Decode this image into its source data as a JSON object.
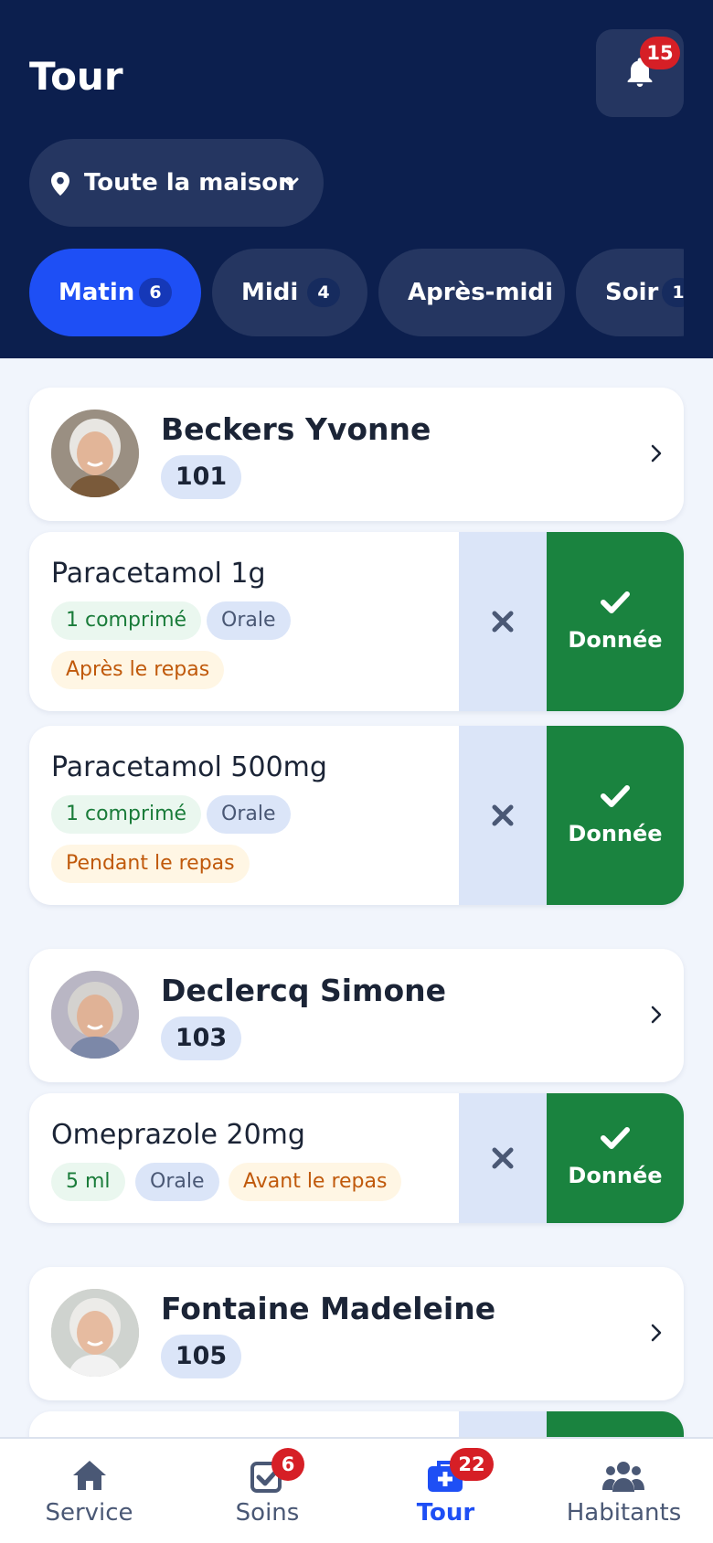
{
  "header": {
    "title": "Tour",
    "notifications_count": "15",
    "location_label": "Toute la maison",
    "tabs": [
      {
        "label": "Matin",
        "count": "6",
        "active": true
      },
      {
        "label": "Midi",
        "count": "4",
        "active": false
      },
      {
        "label": "Après-midi",
        "count": "",
        "active": false
      },
      {
        "label": "Soir",
        "count": "1",
        "active": false
      }
    ]
  },
  "residents": [
    {
      "name": "Beckers Yvonne",
      "room": "101",
      "medications": [
        {
          "name": "Paracetamol 1g",
          "dose": "1 comprimé",
          "route": "Orale",
          "timing": "Après le repas"
        },
        {
          "name": "Paracetamol 500mg",
          "dose": "1 comprimé",
          "route": "Orale",
          "timing": "Pendant le repas"
        }
      ]
    },
    {
      "name": "Declercq Simone",
      "room": "103",
      "medications": [
        {
          "name": "Omeprazole 20mg",
          "dose": "5 ml",
          "route": "Orale",
          "timing": "Avant le repas"
        }
      ]
    },
    {
      "name": "Fontaine Madeleine",
      "room": "105",
      "medications": []
    }
  ],
  "actions": {
    "given_label": "Donnée"
  },
  "bottom_nav": [
    {
      "label": "Service",
      "icon": "home-icon",
      "badge": ""
    },
    {
      "label": "Soins",
      "icon": "checkbox-icon",
      "badge": "6"
    },
    {
      "label": "Tour",
      "icon": "medical-kit-icon",
      "badge": "22",
      "active": true
    },
    {
      "label": "Habitants",
      "icon": "users-icon",
      "badge": ""
    }
  ],
  "colors": {
    "header_bg": "#0c1f4e",
    "accent": "#1e4ff5",
    "given_green": "#1a833f",
    "badge_red": "#d61f26"
  }
}
